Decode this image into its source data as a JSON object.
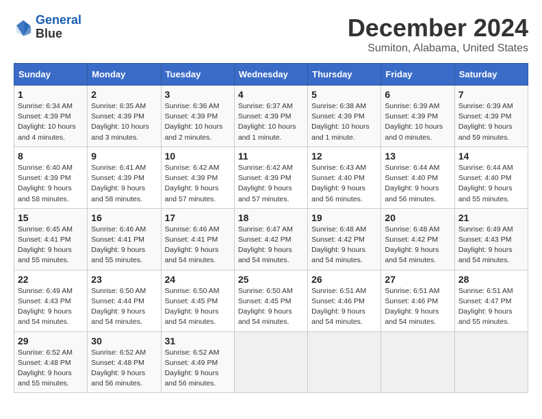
{
  "header": {
    "logo_line1": "General",
    "logo_line2": "Blue",
    "title": "December 2024",
    "subtitle": "Sumiton, Alabama, United States"
  },
  "weekdays": [
    "Sunday",
    "Monday",
    "Tuesday",
    "Wednesday",
    "Thursday",
    "Friday",
    "Saturday"
  ],
  "weeks": [
    [
      {
        "day": "1",
        "sunrise": "6:34 AM",
        "sunset": "4:39 PM",
        "daylight": "10 hours and 4 minutes."
      },
      {
        "day": "2",
        "sunrise": "6:35 AM",
        "sunset": "4:39 PM",
        "daylight": "10 hours and 3 minutes."
      },
      {
        "day": "3",
        "sunrise": "6:36 AM",
        "sunset": "4:39 PM",
        "daylight": "10 hours and 2 minutes."
      },
      {
        "day": "4",
        "sunrise": "6:37 AM",
        "sunset": "4:39 PM",
        "daylight": "10 hours and 1 minute."
      },
      {
        "day": "5",
        "sunrise": "6:38 AM",
        "sunset": "4:39 PM",
        "daylight": "10 hours and 1 minute."
      },
      {
        "day": "6",
        "sunrise": "6:39 AM",
        "sunset": "4:39 PM",
        "daylight": "10 hours and 0 minutes."
      },
      {
        "day": "7",
        "sunrise": "6:39 AM",
        "sunset": "4:39 PM",
        "daylight": "9 hours and 59 minutes."
      }
    ],
    [
      {
        "day": "8",
        "sunrise": "6:40 AM",
        "sunset": "4:39 PM",
        "daylight": "9 hours and 58 minutes."
      },
      {
        "day": "9",
        "sunrise": "6:41 AM",
        "sunset": "4:39 PM",
        "daylight": "9 hours and 58 minutes."
      },
      {
        "day": "10",
        "sunrise": "6:42 AM",
        "sunset": "4:39 PM",
        "daylight": "9 hours and 57 minutes."
      },
      {
        "day": "11",
        "sunrise": "6:42 AM",
        "sunset": "4:39 PM",
        "daylight": "9 hours and 57 minutes."
      },
      {
        "day": "12",
        "sunrise": "6:43 AM",
        "sunset": "4:40 PM",
        "daylight": "9 hours and 56 minutes."
      },
      {
        "day": "13",
        "sunrise": "6:44 AM",
        "sunset": "4:40 PM",
        "daylight": "9 hours and 56 minutes."
      },
      {
        "day": "14",
        "sunrise": "6:44 AM",
        "sunset": "4:40 PM",
        "daylight": "9 hours and 55 minutes."
      }
    ],
    [
      {
        "day": "15",
        "sunrise": "6:45 AM",
        "sunset": "4:41 PM",
        "daylight": "9 hours and 55 minutes."
      },
      {
        "day": "16",
        "sunrise": "6:46 AM",
        "sunset": "4:41 PM",
        "daylight": "9 hours and 55 minutes."
      },
      {
        "day": "17",
        "sunrise": "6:46 AM",
        "sunset": "4:41 PM",
        "daylight": "9 hours and 54 minutes."
      },
      {
        "day": "18",
        "sunrise": "6:47 AM",
        "sunset": "4:42 PM",
        "daylight": "9 hours and 54 minutes."
      },
      {
        "day": "19",
        "sunrise": "6:48 AM",
        "sunset": "4:42 PM",
        "daylight": "9 hours and 54 minutes."
      },
      {
        "day": "20",
        "sunrise": "6:48 AM",
        "sunset": "4:42 PM",
        "daylight": "9 hours and 54 minutes."
      },
      {
        "day": "21",
        "sunrise": "6:49 AM",
        "sunset": "4:43 PM",
        "daylight": "9 hours and 54 minutes."
      }
    ],
    [
      {
        "day": "22",
        "sunrise": "6:49 AM",
        "sunset": "4:43 PM",
        "daylight": "9 hours and 54 minutes."
      },
      {
        "day": "23",
        "sunrise": "6:50 AM",
        "sunset": "4:44 PM",
        "daylight": "9 hours and 54 minutes."
      },
      {
        "day": "24",
        "sunrise": "6:50 AM",
        "sunset": "4:45 PM",
        "daylight": "9 hours and 54 minutes."
      },
      {
        "day": "25",
        "sunrise": "6:50 AM",
        "sunset": "4:45 PM",
        "daylight": "9 hours and 54 minutes."
      },
      {
        "day": "26",
        "sunrise": "6:51 AM",
        "sunset": "4:46 PM",
        "daylight": "9 hours and 54 minutes."
      },
      {
        "day": "27",
        "sunrise": "6:51 AM",
        "sunset": "4:46 PM",
        "daylight": "9 hours and 54 minutes."
      },
      {
        "day": "28",
        "sunrise": "6:51 AM",
        "sunset": "4:47 PM",
        "daylight": "9 hours and 55 minutes."
      }
    ],
    [
      {
        "day": "29",
        "sunrise": "6:52 AM",
        "sunset": "4:48 PM",
        "daylight": "9 hours and 55 minutes."
      },
      {
        "day": "30",
        "sunrise": "6:52 AM",
        "sunset": "4:48 PM",
        "daylight": "9 hours and 56 minutes."
      },
      {
        "day": "31",
        "sunrise": "6:52 AM",
        "sunset": "4:49 PM",
        "daylight": "9 hours and 56 minutes."
      },
      null,
      null,
      null,
      null
    ]
  ]
}
